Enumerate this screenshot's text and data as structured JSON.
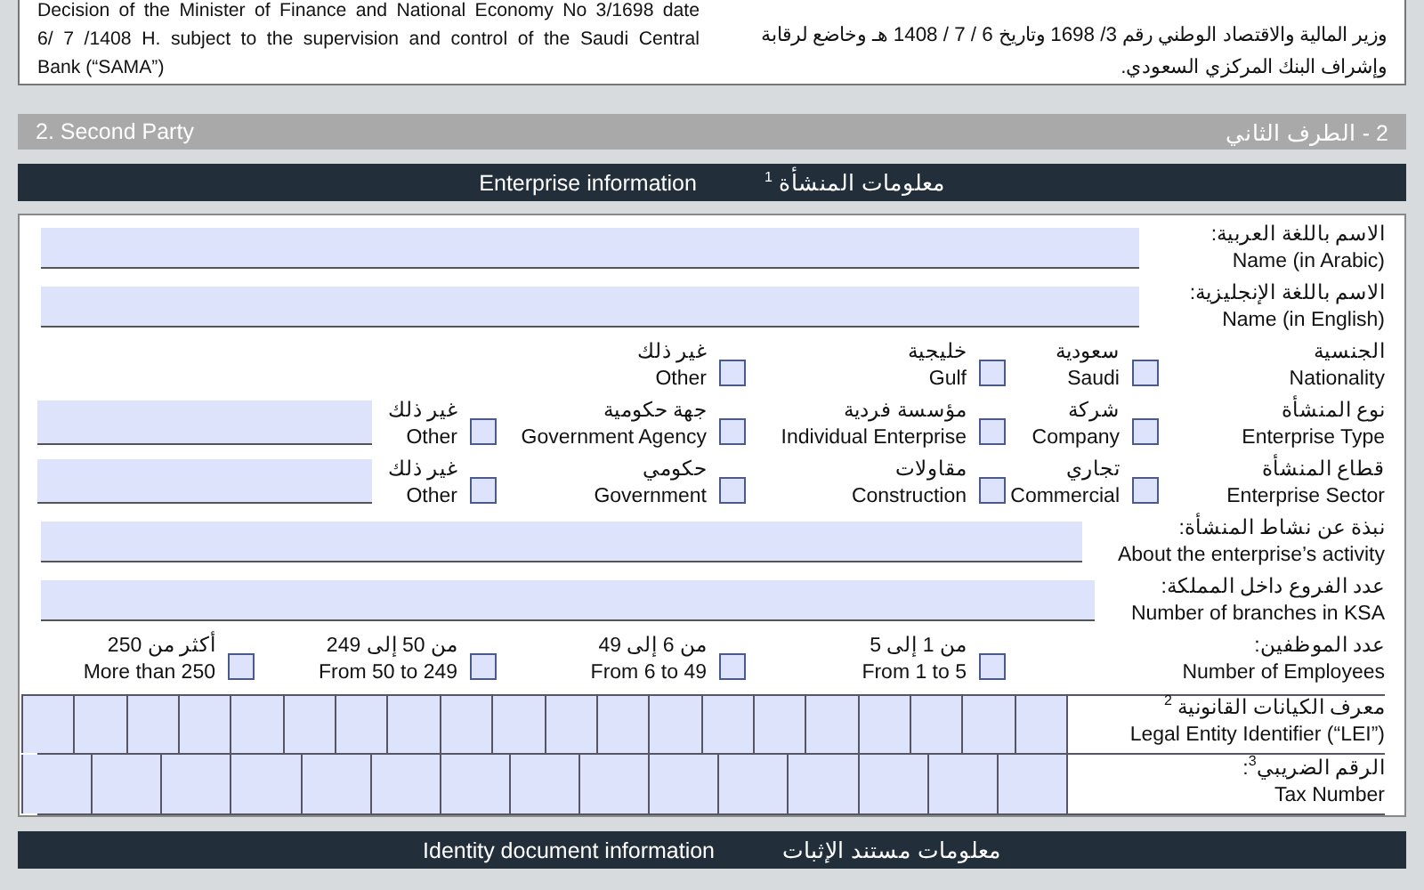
{
  "intro": {
    "english_lines": [
      "Decision of the Minister of Finance and National Economy No 3/1698 date",
      "6/ 7 /1408 H. subject to the supervision and control of the Saudi Central",
      "Bank (“SAMA”)"
    ],
    "arabic_lines": [
      "وزير المالية والاقتصاد الوطني رقم 3/ 1698 وتاريخ 6 / 7 / 1408 هـ وخاضع لرقابة",
      "وإشراف البنك المركزي السعودي."
    ]
  },
  "section": {
    "english": "2. Second Party",
    "arabic": "2 - الطرف الثاني"
  },
  "enterprise": {
    "header": {
      "english": "Enterprise information",
      "arabic": "معلومات المنشأة $^{1}$"
    },
    "rows": [
      {
        "kind": "text",
        "label_ar": "الاسم باللغة العربية:",
        "label_en": "Name (in Arabic)"
      },
      {
        "kind": "text",
        "label_ar": "الاسم باللغة الإنجليزية:",
        "label_en": "Name (in English)"
      },
      {
        "kind": "choice",
        "label_ar": "الجنسية",
        "label_en": "Nationality",
        "has_text_field": false,
        "options": [
          {
            "ar": "سعودية",
            "en": "Saudi",
            "checked": false
          },
          {
            "ar": "خليجية",
            "en": "Gulf",
            "checked": false
          },
          {
            "ar": "غير ذلك",
            "en": "Other",
            "checked": false
          }
        ]
      },
      {
        "kind": "choice",
        "label_ar": "نوع المنشأة",
        "label_en": "Enterprise Type",
        "has_text_field": true,
        "options": [
          {
            "ar": "شركة",
            "en": "Company",
            "checked": false
          },
          {
            "ar": "مؤسسة فردية",
            "en": "Individual Enterprise",
            "checked": false
          },
          {
            "ar": "جهة حكومية",
            "en": "Government Agency",
            "checked": false
          },
          {
            "ar": "غير ذلك",
            "en": "Other",
            "checked": false
          }
        ]
      },
      {
        "kind": "choice",
        "label_ar": "قطاع المنشأة",
        "label_en": "Enterprise Sector",
        "has_text_field": true,
        "options": [
          {
            "ar": "تجاري",
            "en": "Commercial",
            "checked": false
          },
          {
            "ar": "مقاولات",
            "en": "Construction",
            "checked": false
          },
          {
            "ar": "حكومي",
            "en": "Government",
            "checked": false
          },
          {
            "ar": "غير ذلك",
            "en": "Other",
            "checked": false
          }
        ]
      },
      {
        "kind": "text",
        "label_ar": "نبذة عن نشاط المنشأة:",
        "label_en": "About the enterprise’s activity"
      },
      {
        "kind": "text",
        "label_ar": "عدد الفروع داخل المملكة:",
        "label_en": "Number of branches in KSA"
      },
      {
        "kind": "scale",
        "label_ar": "عدد الموظفين:",
        "label_en": "Number of Employees",
        "has_text_field": false,
        "options": [
          {
            "ar": "من 1 إلى 5",
            "en": "From 1 to 5",
            "checked": false
          },
          {
            "ar": "من 6 إلى 49",
            "en": "From 6 to 49",
            "checked": false
          },
          {
            "ar": "من 50 إلى 249",
            "en": "From 50 to 249",
            "checked": false
          },
          {
            "ar": "أكثر من 250",
            "en": "More than 250",
            "checked": false
          }
        ]
      },
      {
        "kind": "lei",
        "label_ar": "معرف الكيانات القانونية $^{2}$",
        "label_en": "Legal Entity Identifier (“LEI”)"
      },
      {
        "kind": "tax",
        "label_ar": "الرقم الضريبي$^{3}$:",
        "label_en": "Tax Number"
      }
    ]
  },
  "next_header": {
    "english": "Identity document information",
    "arabic": "معلومات مستند الإثبات"
  }
}
